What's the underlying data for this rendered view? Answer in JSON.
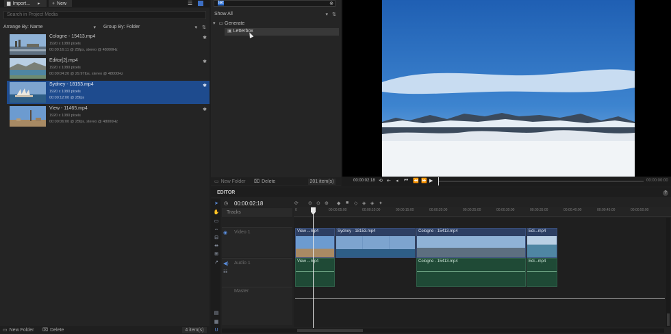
{
  "toolbar": {
    "import_label": "Import...",
    "new_label": "New"
  },
  "media": {
    "search_placeholder": "Search in Project Media",
    "arrange_label": "Arrange By: Name",
    "group_label": "Group By: Folder",
    "items": [
      {
        "title": "Cologne - 15413.mp4",
        "res": "1920 x 1080 pixels",
        "info": "00:00:16:11 @ 25fps, stereo @ 48000Hz",
        "selected": false
      },
      {
        "title": "Editor[2].mp4",
        "res": "1920 x 1080 pixels",
        "info": "00:00:04:20 @ 29.97fps, stereo @ 48000Hz",
        "selected": false
      },
      {
        "title": "Sydney - 18153.mp4",
        "res": "1920 x 1080 pixels",
        "info": "00:00:12:00 @ 25fps",
        "selected": true
      },
      {
        "title": "View - 11465.mp4",
        "res": "1920 x 1080 pixels",
        "info": "00:00:06:00 @ 25fps, stereo @ 48000Hz",
        "selected": false
      }
    ],
    "new_folder_label": "New Folder",
    "delete_label": "Delete",
    "count_label": "4 item(s)"
  },
  "effects": {
    "search_value": "let",
    "filter_label": "Show All",
    "tree_folder": "Generate",
    "tree_item": "Letterbox",
    "new_folder_label": "New Folder",
    "delete_label": "Delete",
    "count_label": "201 item(s)"
  },
  "viewer": {
    "timecode": "00:00:02:18",
    "end_timecode": "00:00:00:00"
  },
  "editor": {
    "title": "EDITOR",
    "help": "?",
    "timecode": "00:00:02:18",
    "tracks_label": "Tracks",
    "video_track": "Video 1",
    "audio_track": "Audio 1",
    "master_track": "Master",
    "ruler": [
      "0",
      "00:00:05:00",
      "00:00:10:00",
      "00:00:15:00",
      "00:00:20:00",
      "00:00:25:00",
      "00:00:30:00",
      "00:00:35:00",
      "00:00:40:00",
      "00:00:45:00",
      "00:00:50:00"
    ],
    "video_clips": [
      "View ...mp4",
      "Sydney - 18153.mp4",
      "Cologne - 15413.mp4",
      "Edi...mp4"
    ],
    "audio_clips": [
      "View ...mp4",
      "Cologne - 15413.mp4",
      "Edi...mp4"
    ]
  },
  "colors": {
    "accent": "#1e4b8e",
    "audio": "#1f4a36",
    "video": "#2d3f63"
  }
}
